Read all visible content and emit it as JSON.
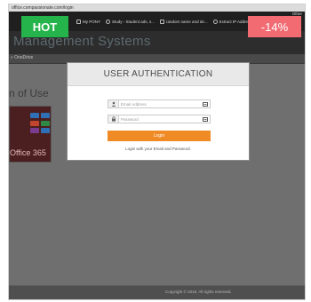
{
  "browser": {
    "url": "office.compassionate.com/login",
    "bookmarks": [
      {
        "label": "My PONY",
        "icon": "bookmark-icon"
      },
      {
        "label": "Study - Student ads, s...",
        "icon": "globe-icon"
      },
      {
        "label": "random name and de...",
        "icon": "bookmark-icon"
      },
      {
        "label": "Extract IP Addresses F...",
        "icon": "globe-icon"
      }
    ],
    "more_bookmarks": "Other"
  },
  "site": {
    "title": "Management Systems",
    "breadcrumb": "» OneDrive",
    "terms_heading": "n of Use",
    "office_text": "Office 365",
    "footer": "Copyright © 2016. All rights reserved."
  },
  "modal": {
    "title": "USER AUTHENTICATION",
    "email_placeholder": "Email Address",
    "password_placeholder": "Password",
    "login_label": "Login",
    "helper_text": "Login with your Email and Password."
  },
  "badges": {
    "hot": "HOT",
    "change": "-14%"
  },
  "colors": {
    "hot_badge": "#25b34b",
    "change_badge": "#f26b72",
    "login_button": "#f08a24",
    "overlay": "#6f6f6f"
  }
}
